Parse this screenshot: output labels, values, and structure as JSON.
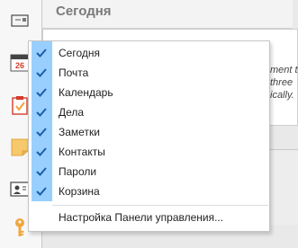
{
  "today": {
    "title": "Сегодня"
  },
  "sidebar": {
    "items": [
      {
        "icon": "mail-icon"
      },
      {
        "icon": "calendar-icon",
        "day": "26"
      },
      {
        "icon": "tasks-icon"
      },
      {
        "icon": "notes-icon"
      },
      {
        "icon": "contacts-icon"
      },
      {
        "icon": "key-icon"
      }
    ]
  },
  "background_snippets": [
    "ment th",
    "three",
    "ically."
  ],
  "menu": {
    "items": [
      {
        "label": "Сегодня",
        "checked": true
      },
      {
        "label": "Почта",
        "checked": true
      },
      {
        "label": "Календарь",
        "checked": true
      },
      {
        "label": "Дела",
        "checked": true
      },
      {
        "label": "Заметки",
        "checked": true
      },
      {
        "label": "Контакты",
        "checked": true
      },
      {
        "label": "Пароли",
        "checked": true
      },
      {
        "label": "Корзина",
        "checked": true
      }
    ],
    "settings_label": "Настройка Панели управления..."
  },
  "colors": {
    "check_column": "#99cfff",
    "check_mark": "#1a5ea8",
    "calendar_red": "#d23b2a",
    "notes_orange": "#f2a23a",
    "key_orange": "#f0a640"
  }
}
